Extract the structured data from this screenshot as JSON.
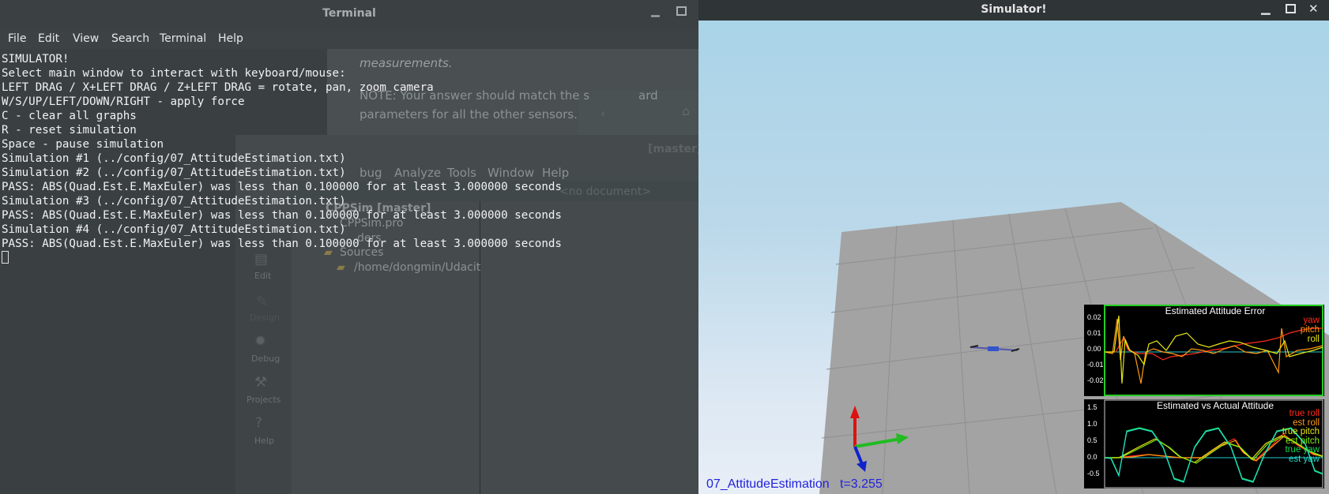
{
  "terminal": {
    "title": "Terminal",
    "menu": [
      "File",
      "Edit",
      "View",
      "Search",
      "Terminal",
      "Help"
    ],
    "output": [
      "SIMULATOR!",
      "Select main window to interact with keyboard/mouse:",
      "LEFT DRAG / X+LEFT DRAG / Z+LEFT DRAG = rotate, pan, zoom camera",
      "W/S/UP/LEFT/DOWN/RIGHT - apply force",
      "C - clear all graphs",
      "R - reset simulation",
      "Space - pause simulation",
      "Simulation #1 (../config/07_AttitudeEstimation.txt)",
      "Simulation #2 (../config/07_AttitudeEstimation.txt)",
      "PASS: ABS(Quad.Est.E.MaxEuler) was less than 0.100000 for at least 3.000000 seconds",
      "Simulation #3 (../config/07_AttitudeEstimation.txt)",
      "PASS: ABS(Quad.Est.E.MaxEuler) was less than 0.100000 for at least 3.000000 seconds",
      "Simulation #4 (../config/07_AttitudeEstimation.txt)",
      "PASS: ABS(Quad.Est.E.MaxEuler) was less than 0.100000 for at least 3.000000 seconds"
    ]
  },
  "background": {
    "doc_line1": "measurements.",
    "doc_line2": "NOTE: Your answer should match the s",
    "doc_line2b": "ard",
    "doc_line3": "parameters for all the other sensors.",
    "ide_branch": "[master]",
    "ide_menu": [
      "bug",
      "Analyze",
      "Tools",
      "Window",
      "Help"
    ],
    "ide_no_document": "<no document>",
    "ide_project": "CPPSim [master]",
    "ide_pro_file": "CPPSim.pro",
    "ide_headers": "ders",
    "ide_sources": "Sources",
    "ide_path": "/home/dongmin/Udacit",
    "ide_modes": [
      "Edit",
      "Design",
      "Debug",
      "Projects",
      "Help"
    ]
  },
  "simulator": {
    "title": "Simulator!",
    "status": "07_AttitudeEstimation   t=3.255",
    "plots": [
      {
        "title": "Estimated Attitude Error",
        "y_ticks": [
          "0.02",
          "0.01",
          "0.00",
          "-0.01",
          "-0.02"
        ],
        "legend": [
          {
            "label": "yaw",
            "color": "#ff2a1a"
          },
          {
            "label": "pitch",
            "color": "#ff9a10"
          },
          {
            "label": "roll",
            "color": "#e6e614"
          }
        ],
        "border_color": "#22cc22"
      },
      {
        "title": "Estimated vs Actual Attitude",
        "y_ticks": [
          "1.5",
          "1.0",
          "0.5",
          "0.0",
          "-0.5"
        ],
        "legend": [
          {
            "label": "true roll",
            "color": "#ff2a1a"
          },
          {
            "label": "est roll",
            "color": "#ff9a10"
          },
          {
            "label": "true pitch",
            "color": "#e6e614"
          },
          {
            "label": "est pitch",
            "color": "#88ee10"
          },
          {
            "label": "true yaw",
            "color": "#11dd55"
          },
          {
            "label": "est yaw",
            "color": "#22ddcc"
          }
        ]
      }
    ]
  },
  "colors": {
    "terminal_bg": "#3a4042",
    "terminal_text": "#f2f2f2",
    "titlebar": "#2f3436",
    "sky_top": "#a8d3e8",
    "ground_plane": "#a3a3a3",
    "status_text": "#2222dd"
  }
}
